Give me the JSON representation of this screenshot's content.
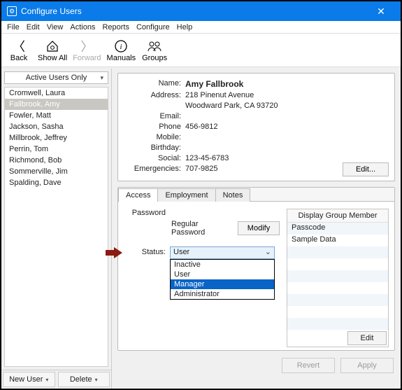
{
  "window": {
    "title": "Configure Users"
  },
  "menu": [
    "File",
    "Edit",
    "View",
    "Actions",
    "Reports",
    "Configure",
    "Help"
  ],
  "toolbar": {
    "back": "Back",
    "showall": "Show All",
    "forward": "Forward",
    "manuals": "Manuals",
    "groups": "Groups"
  },
  "sidebar": {
    "filter": "Active Users Only",
    "users": [
      {
        "label": "Cromwell, Laura",
        "selected": false
      },
      {
        "label": "Fallbrook, Amy",
        "selected": true
      },
      {
        "label": "Fowler, Matt",
        "selected": false
      },
      {
        "label": "Jackson, Sasha",
        "selected": false
      },
      {
        "label": "Millbrook, Jeffrey",
        "selected": false
      },
      {
        "label": "Perrin, Tom",
        "selected": false
      },
      {
        "label": "Richmond, Bob",
        "selected": false
      },
      {
        "label": "Sommerville, Jim",
        "selected": false
      },
      {
        "label": "Spalding, Dave",
        "selected": false
      }
    ],
    "newuser": "New User",
    "delete": "Delete"
  },
  "details": {
    "labels": {
      "name": "Name:",
      "address": "Address:",
      "email": "Email:",
      "phone": "Phone",
      "mobile": "Mobile:",
      "birthday": "Birthday:",
      "social": "Social:",
      "emergencies": "Emergencies:"
    },
    "name": "Amy Fallbrook",
    "address1": "218 Pinenut Avenue",
    "address2": "Woodward Park, CA 93720",
    "email": "",
    "phone": "456-9812",
    "mobile": "",
    "birthday": "",
    "social": "123-45-6783",
    "emergencies": "707-9825",
    "edit": "Edit..."
  },
  "tabs": {
    "access": "Access",
    "employment": "Employment",
    "notes": "Notes"
  },
  "access": {
    "password_label": "Password",
    "password_value": "Regular Password",
    "modify": "Modify",
    "status_label": "Status:",
    "status_value": "User",
    "status_options": [
      "Inactive",
      "User",
      "Manager",
      "Administrator"
    ],
    "status_highlight": "Manager"
  },
  "group": {
    "header": "Display Group Member",
    "rows": [
      "Passcode",
      "Sample Data",
      "",
      "",
      "",
      "",
      "",
      "",
      ""
    ],
    "edit": "Edit"
  },
  "footer": {
    "revert": "Revert",
    "apply": "Apply"
  }
}
